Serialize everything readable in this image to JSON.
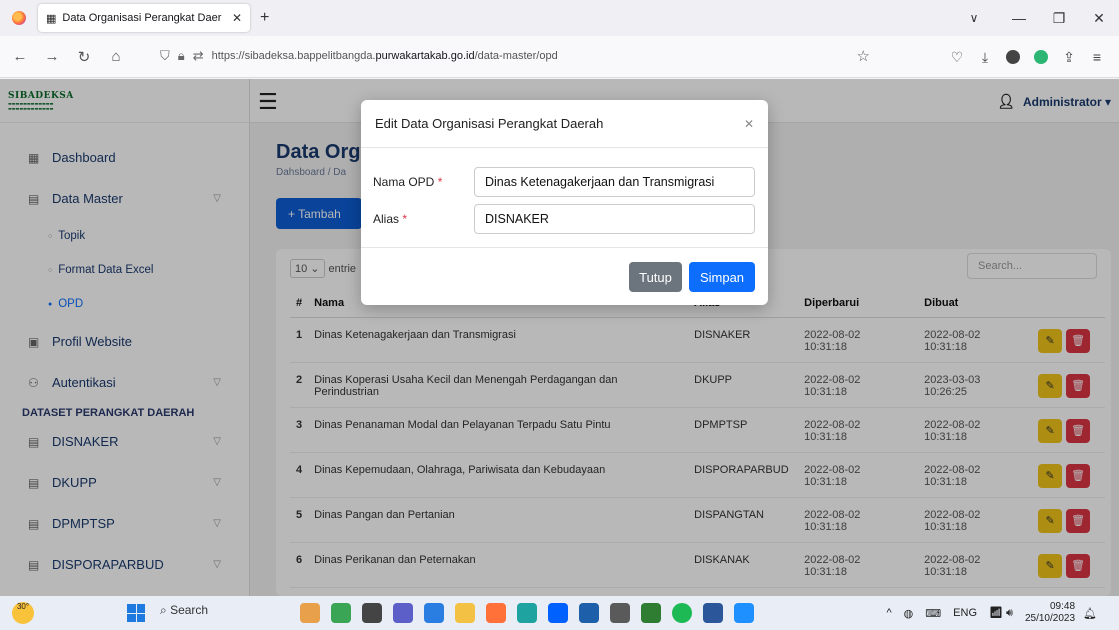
{
  "browser": {
    "tab_title": "Data Organisasi Perangkat Daer",
    "url_prefix": "https://sibadeksa.bappelitbangda.",
    "url_domain": "purwakartakab.go.id",
    "url_path": "/data-master/opd"
  },
  "app": {
    "logo": "SIBADEKSA",
    "user": "Administrator"
  },
  "sidebar": {
    "dashboard": "Dashboard",
    "data_master": "Data Master",
    "sub_items": [
      "Topik",
      "Format Data Excel",
      "OPD"
    ],
    "profil_website": "Profil Website",
    "autentikasi": "Autentikasi",
    "section_title": "DATASET PERANGKAT DAERAH",
    "datasets": [
      "DISNAKER",
      "DKUPP",
      "DPMPTSP",
      "DISPORAPARBUD"
    ]
  },
  "page": {
    "title": "Data Orga",
    "breadcrumb": "Dahsboard / Da",
    "add_button": "+ Tambah",
    "entries_value": "10",
    "entries_text": "entrie",
    "search_placeholder": "Search..."
  },
  "table": {
    "headers": [
      "#",
      "Nama",
      "Alias",
      "Diperbarui",
      "Dibuat",
      ""
    ],
    "rows": [
      {
        "no": "1",
        "nama": "Dinas Ketenagakerjaan dan Transmigrasi",
        "alias": "DISNAKER",
        "diperbarui_date": "2022-08-02",
        "diperbarui_time": "10:31:18",
        "dibuat_date": "2022-08-02",
        "dibuat_time": "10:31:18"
      },
      {
        "no": "2",
        "nama": "Dinas Koperasi Usaha Kecil dan Menengah Perdagangan dan Perindustrian",
        "alias": "DKUPP",
        "diperbarui_date": "2022-08-02",
        "diperbarui_time": "10:31:18",
        "dibuat_date": "2023-03-03",
        "dibuat_time": "10:26:25"
      },
      {
        "no": "3",
        "nama": "Dinas Penanaman Modal dan Pelayanan Terpadu Satu Pintu",
        "alias": "DPMPTSP",
        "diperbarui_date": "2022-08-02",
        "diperbarui_time": "10:31:18",
        "dibuat_date": "2022-08-02",
        "dibuat_time": "10:31:18"
      },
      {
        "no": "4",
        "nama": "Dinas Kepemudaan, Olahraga, Pariwisata dan Kebudayaan",
        "alias": "DISPORAPARBUD",
        "diperbarui_date": "2022-08-02",
        "diperbarui_time": "10:31:18",
        "dibuat_date": "2022-08-02",
        "dibuat_time": "10:31:18"
      },
      {
        "no": "5",
        "nama": "Dinas Pangan dan Pertanian",
        "alias": "DISPANGTAN",
        "diperbarui_date": "2022-08-02",
        "diperbarui_time": "10:31:18",
        "dibuat_date": "2022-08-02",
        "dibuat_time": "10:31:18"
      },
      {
        "no": "6",
        "nama": "Dinas Perikanan dan Peternakan",
        "alias": "DISKANAK",
        "diperbarui_date": "2022-08-02",
        "diperbarui_time": "10:31:18",
        "dibuat_date": "2022-08-02",
        "dibuat_time": "10:31:18"
      }
    ]
  },
  "modal": {
    "title": "Edit Data Organisasi Perangkat Daerah",
    "nama_label": "Nama OPD",
    "nama_value": "Dinas Ketenagakerjaan dan Transmigrasi",
    "alias_label": "Alias",
    "alias_value": "DISNAKER",
    "close_button": "Tutup",
    "save_button": "Simpan"
  },
  "taskbar": {
    "weather": "30°",
    "search": "Search",
    "lang": "ENG",
    "time": "09:48",
    "date": "25/10/2023"
  },
  "colors": {
    "primary": "#0d6efd",
    "danger": "#dc3545",
    "warning": "#f0c419"
  }
}
